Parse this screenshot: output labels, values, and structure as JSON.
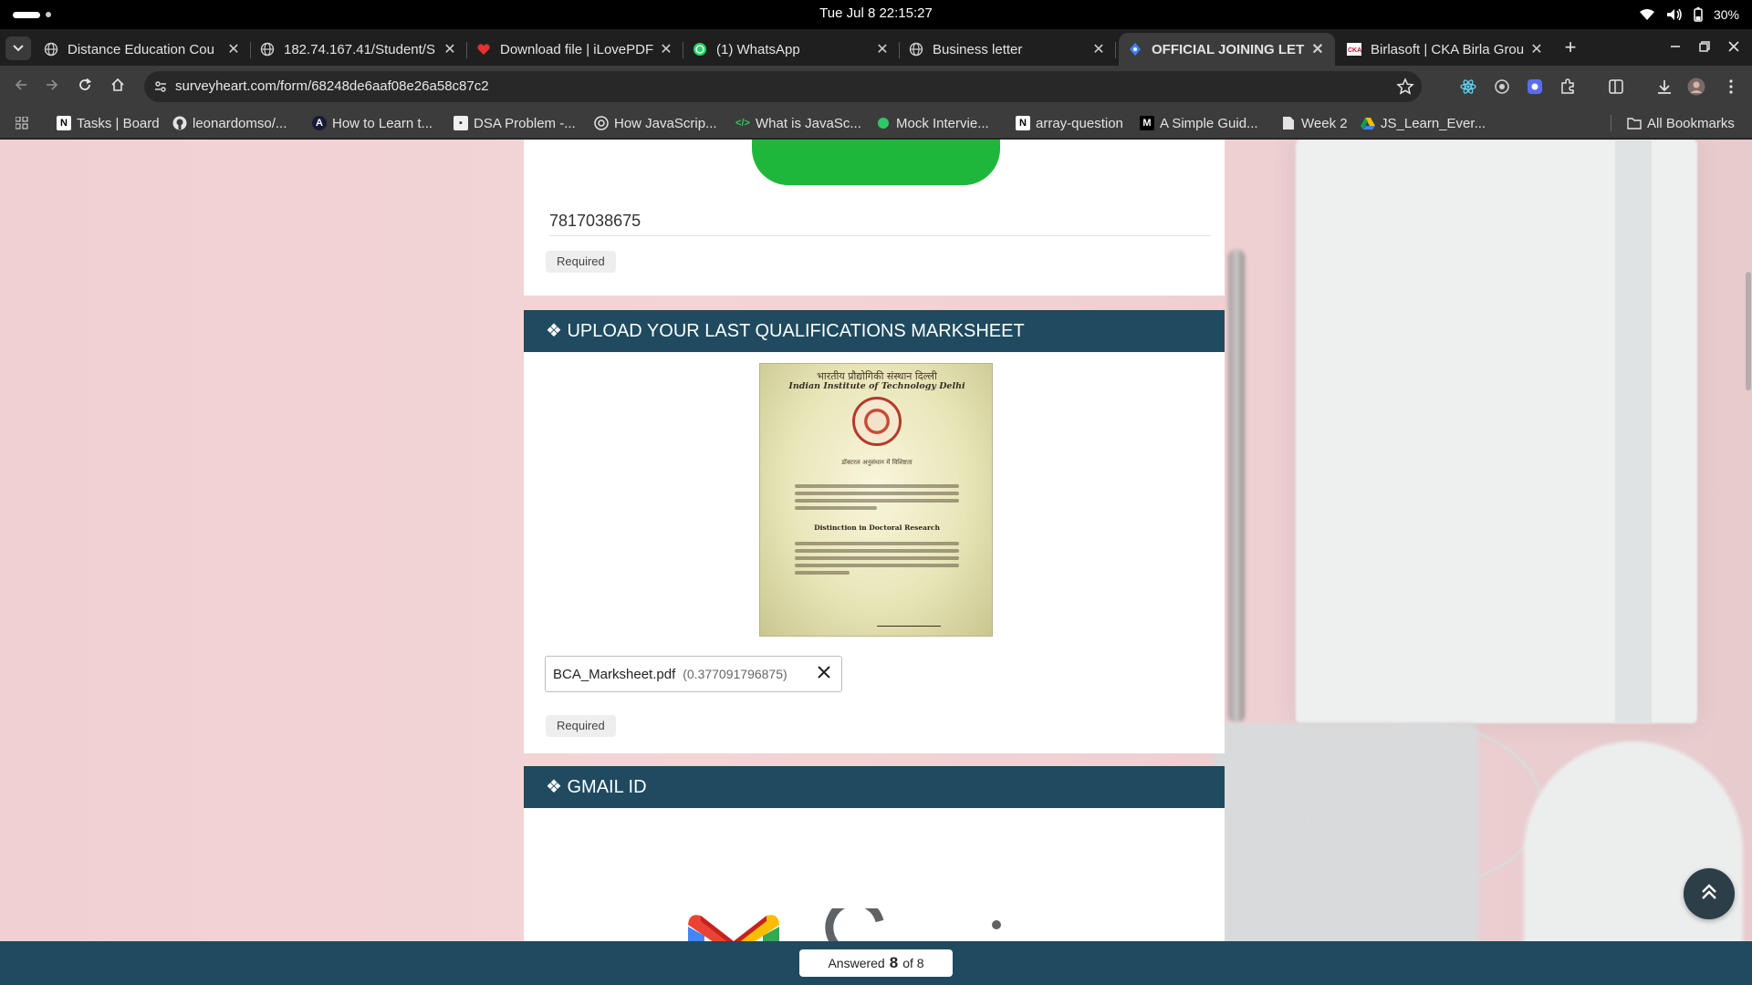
{
  "system": {
    "clock": "Tue Jul 8  22:15:27",
    "battery": "30%"
  },
  "tabs": [
    {
      "title": "Distance Education Cou",
      "icon": "globe-icon"
    },
    {
      "title": "182.74.167.41/Student/S",
      "icon": "globe-icon"
    },
    {
      "title": "Download file | iLovePDF",
      "icon": "heart-icon"
    },
    {
      "title": "(1) WhatsApp",
      "icon": "whatsapp-icon"
    },
    {
      "title": "Business letter",
      "icon": "globe-icon"
    },
    {
      "title": "OFFICIAL JOINING LET",
      "icon": "form-icon"
    },
    {
      "title": "Birlasoft | CKA Birla Grou",
      "icon": "birlasoft-icon"
    }
  ],
  "address_bar": {
    "url": "surveyheart.com/form/68248de6aaf08e26a58c87c2"
  },
  "bookmarks": {
    "items": [
      {
        "label": "Tasks | Board",
        "icon": "N"
      },
      {
        "label": "leonardomso/...",
        "icon": "github"
      },
      {
        "label": "How to Learn t...",
        "icon": "A"
      },
      {
        "label": "DSA Problem -...",
        "icon": "square"
      },
      {
        "label": "How JavaScrip...",
        "icon": "circle"
      },
      {
        "label": "What is JavaSc...",
        "icon": "code"
      },
      {
        "label": "Mock Intervie...",
        "icon": "dot"
      },
      {
        "label": "array-question",
        "icon": "N"
      },
      {
        "label": "A Simple Guid...",
        "icon": "M"
      },
      {
        "label": "Week 2",
        "icon": "doc"
      },
      {
        "label": "JS_Learn_Ever...",
        "icon": "drive"
      }
    ],
    "all_bookmarks": "All Bookmarks"
  },
  "form": {
    "phone_answer": "7817038675",
    "required_label": "Required",
    "marksheet_section_title": "❖ UPLOAD YOUR LAST QUALIFICATIONS MARKSHEET",
    "marksheet_preview": {
      "institute_hindi": "भारतीय प्रौद्योगिकी संस्थान दिल्ली",
      "institute_english": "Indian Institute of Technology Delhi",
      "subheading": "डॉक्टरल अनुसंधान में विशिष्टता",
      "heading": "Distinction in Doctoral Research"
    },
    "uploaded_file": {
      "name": "BCA_Marksheet.pdf",
      "size": "(0.377091796875)"
    },
    "gmail_section_title": "❖ GMAIL ID"
  },
  "progress": {
    "prefix": "Answered",
    "answered": "8",
    "suffix": "of 8"
  },
  "colors": {
    "header_band": "#1f4a5f",
    "whatsapp_green": "#1fb73b"
  }
}
